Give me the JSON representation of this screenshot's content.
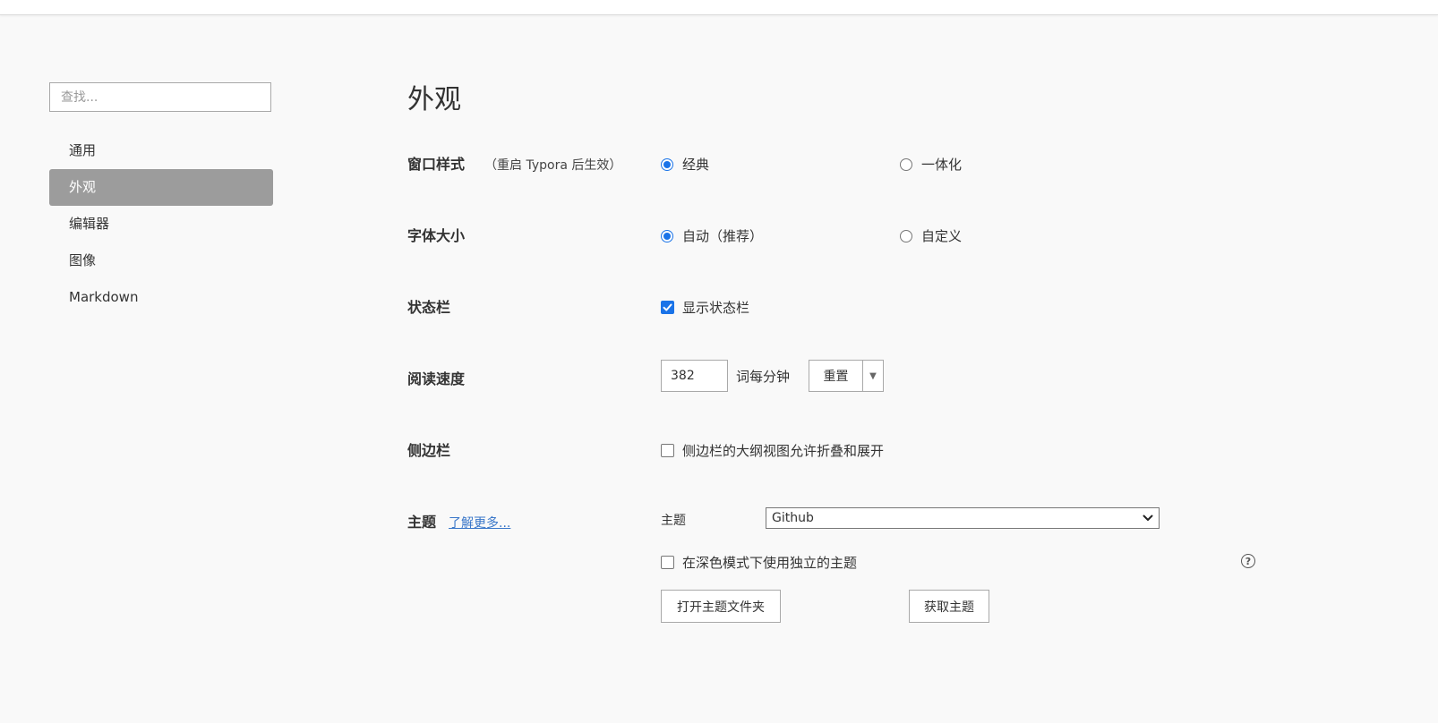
{
  "sidebar": {
    "search_placeholder": "查找...",
    "items": [
      {
        "label": "通用",
        "active": false
      },
      {
        "label": "外观",
        "active": true
      },
      {
        "label": "编辑器",
        "active": false
      },
      {
        "label": "图像",
        "active": false
      },
      {
        "label": "Markdown",
        "active": false
      }
    ]
  },
  "main": {
    "title": "外观",
    "window_style": {
      "label": "窗口样式",
      "note": "（重启 Typora 后生效）",
      "options": [
        "经典",
        "一体化"
      ],
      "selected": "经典"
    },
    "font_size": {
      "label": "字体大小",
      "options": [
        "自动（推荐）",
        "自定义"
      ],
      "selected": "自动（推荐）"
    },
    "status_bar": {
      "label": "状态栏",
      "checkbox_label": "显示状态栏",
      "checked": true
    },
    "reading_speed": {
      "label": "阅读速度",
      "value": "382",
      "unit": "词每分钟",
      "reset_label": "重置"
    },
    "sidebar_setting": {
      "label": "侧边栏",
      "checkbox_label": "侧边栏的大纲视图允许折叠和展开",
      "checked": false
    },
    "theme": {
      "label": "主题",
      "learn_more": "了解更多...",
      "select_label": "主题",
      "selected_theme": "Github",
      "dark_mode_label": "在深色模式下使用独立的主题",
      "dark_mode_checked": false,
      "help": "?",
      "open_folder_label": "打开主题文件夹",
      "get_themes_label": "获取主题"
    }
  },
  "colors": {
    "accent": "#1a73e8",
    "nav_active_bg": "#9c9c9c",
    "link": "#3a77c9",
    "background": "#f9f9f9"
  }
}
